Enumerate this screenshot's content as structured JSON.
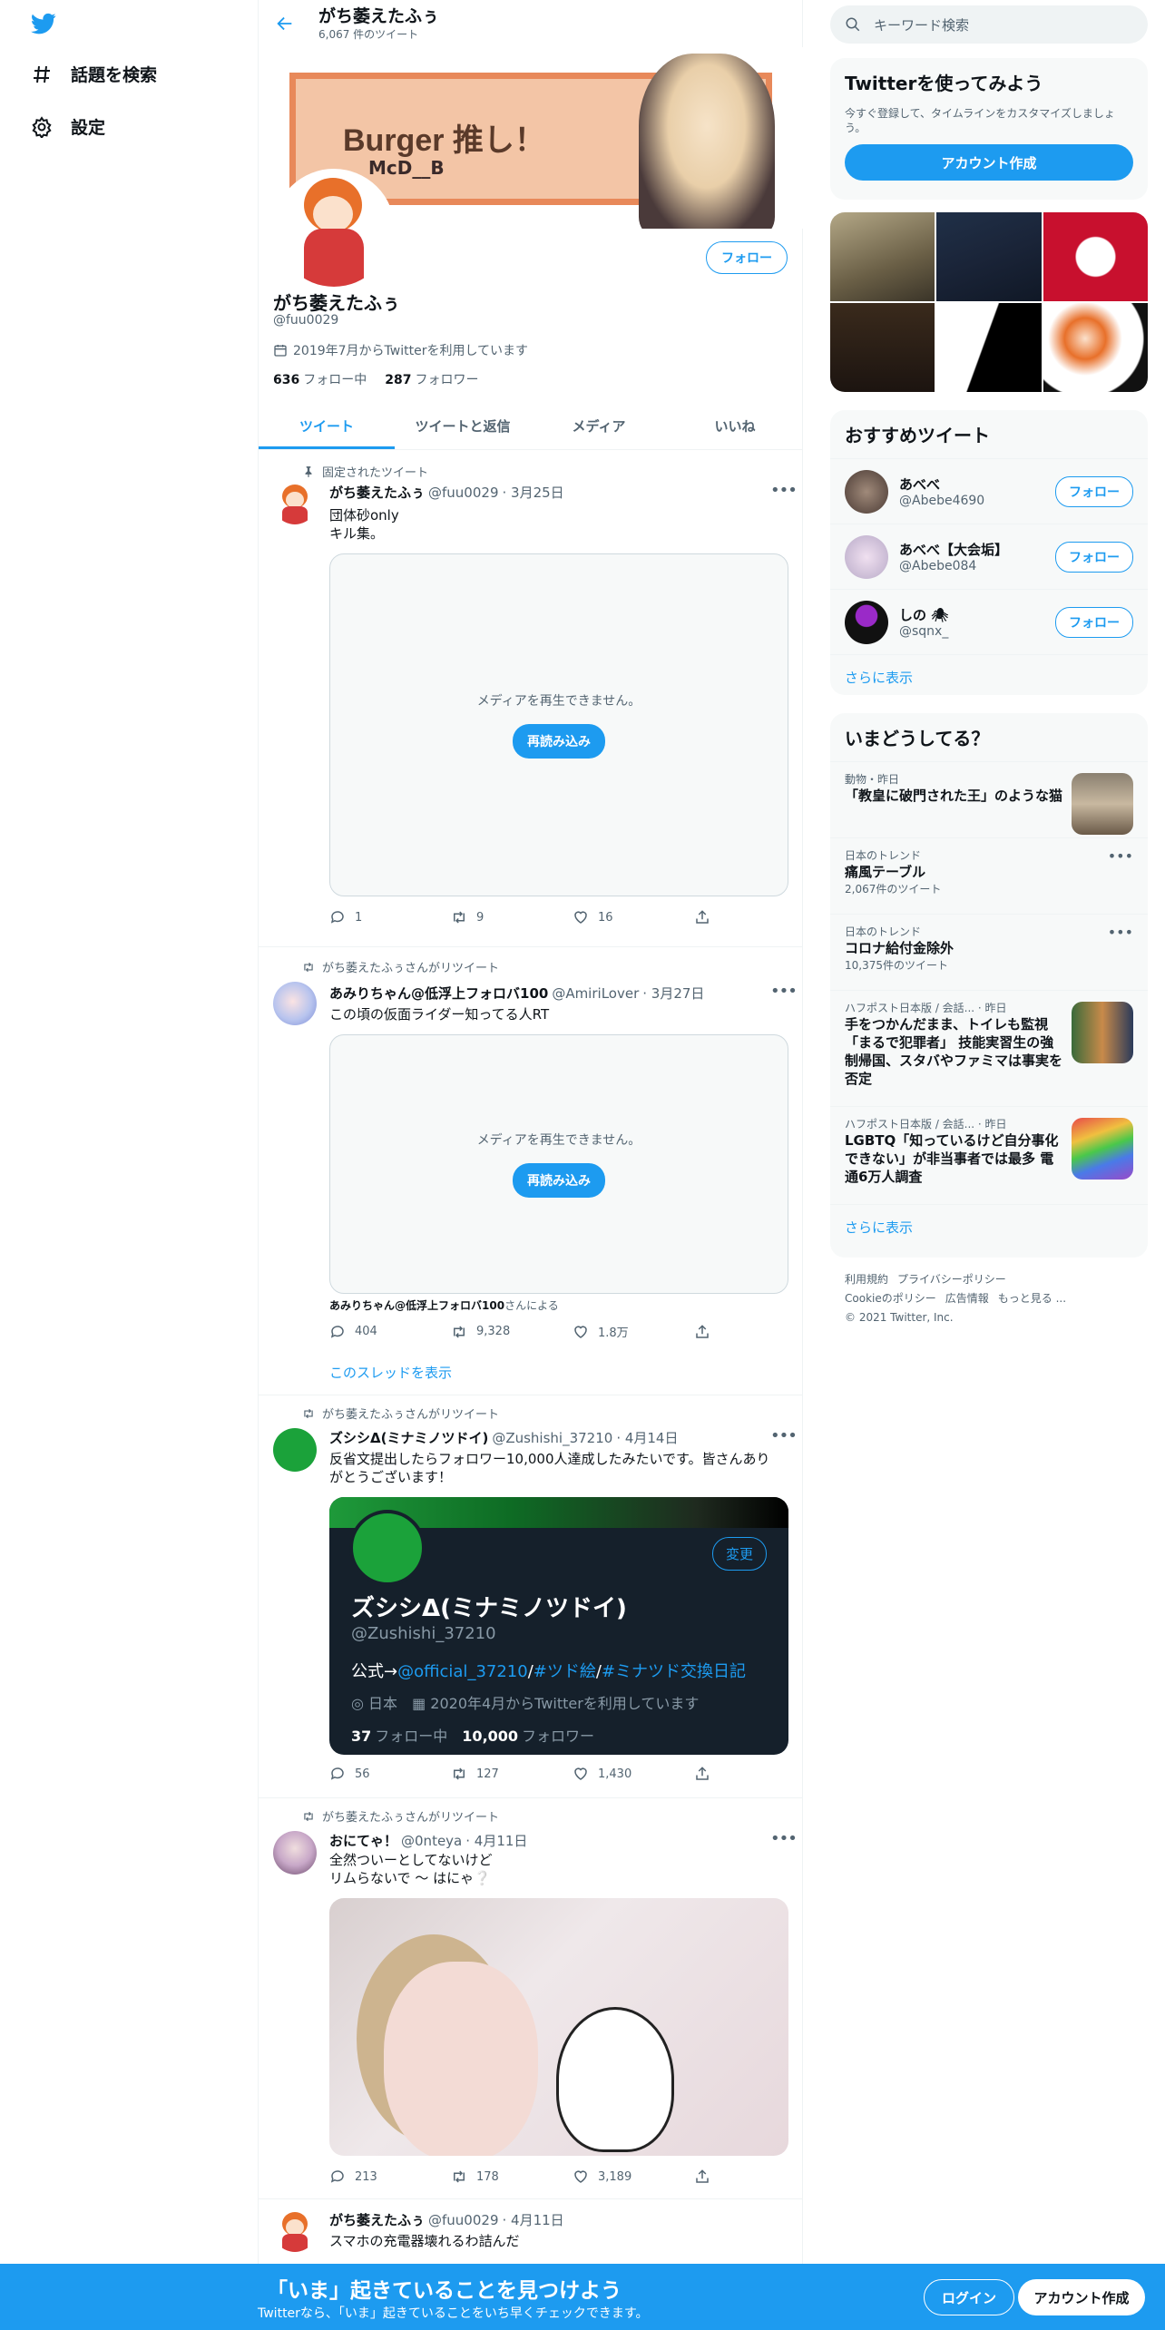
{
  "nav": {
    "explore": "話題を検索",
    "settings": "設定"
  },
  "header": {
    "name": "がち萎えたふぅ",
    "tweet_count": "6,067 件のツイート"
  },
  "banner": {
    "title": "Burger 推し！",
    "sub": "McD__B"
  },
  "profile": {
    "follow": "フォロー",
    "name": "がち萎えたふぅ",
    "handle": "@fuu0029",
    "joined": "2019年7月からTwitterを利用しています",
    "following_count": "636",
    "following_label": "フォロー中",
    "followers_count": "287",
    "followers_label": "フォロワー"
  },
  "tabs": [
    "ツイート",
    "ツイートと返信",
    "メディア",
    "いいね"
  ],
  "tweets": [
    {
      "context": "固定されたツイート",
      "name": "がち萎えたふぅ",
      "handle": "@fuu0029",
      "date": "· 3月25日",
      "text": "団体砂only\nキル集。",
      "media_msg": "メディアを再生できません。",
      "reload": "再読み込み",
      "reply": "1",
      "retweet": "9",
      "like": "16"
    },
    {
      "context": "がち萎えたふぅさんがリツイート",
      "name": "あみりちゃん@低浮上フォロバ100",
      "handle": "@AmiriLover",
      "date": "· 3月27日",
      "text": "この頃の仮面ライダー知ってる人RT",
      "media_msg": "メディアを再生できません。",
      "reload": "再読み込み",
      "by_name": "あみりちゃん@低浮上フォロバ100",
      "by_suffix": "さんによる",
      "reply": "404",
      "retweet": "9,328",
      "like": "1.8万",
      "thread": "このスレッドを表示"
    },
    {
      "context": "がち萎えたふぅさんがリツイート",
      "name": "ズシシΔ(ミナミノツドイ)",
      "handle": "@Zushishi_37210",
      "date": "· 4月14日",
      "text": "反省文提出したらフォロワー10,000人達成したみたいです。皆さんありがとうございます！",
      "card": {
        "change": "変更",
        "name": "ズシシΔ(ミナミノツドイ)",
        "handle": "@Zushishi_37210",
        "bio_prefix": "公式→",
        "bio_link1": "@official_37210",
        "bio_sep1": "/",
        "bio_link2": "#ツド絵",
        "bio_sep2": "/",
        "bio_link3": "#ミナツド交換日記",
        "location": "日本",
        "joined": "2020年4月からTwitterを利用しています",
        "following_count": "37",
        "following_label": "フォロー中",
        "followers_count": "10,000",
        "followers_label": "フォロワー"
      },
      "reply": "56",
      "retweet": "127",
      "like": "1,430"
    },
    {
      "context": "がち萎えたふぅさんがリツイート",
      "name": "おにてゃ！",
      "handle": "@0nteya",
      "date": "· 4月11日",
      "text": "全然ついーとしてないけど\nリムらないで ～ はにゃ❔",
      "reply": "213",
      "retweet": "178",
      "like": "3,189"
    },
    {
      "name": "がち萎えたふぅ",
      "handle": "@fuu0029",
      "date": "· 4月11日",
      "text": "スマホの充電器壊れるわ詰んだ"
    }
  ],
  "right": {
    "search_placeholder": "キーワード検索",
    "signup_title": "Twitterを使ってみよう",
    "signup_desc": "今すぐ登録して、タイムラインをカスタマイズしましょう。",
    "signup_btn": "アカウント作成",
    "rec_title": "おすすめツイート",
    "recs": [
      {
        "name": "あべべ",
        "handle": "@Abebe4690",
        "follow": "フォロー"
      },
      {
        "name": "あべべ【大会垢】",
        "handle": "@Abebe084",
        "follow": "フォロー"
      },
      {
        "name": "しの 🕷",
        "handle": "@sqnx_",
        "follow": "フォロー"
      }
    ],
    "show_more": "さらに表示",
    "trends_title": "いまどうしてる？",
    "trends": [
      {
        "cat": "動物・昨日",
        "title": "「教皇に破門された王」のような猫",
        "count": ""
      },
      {
        "cat": "日本のトレンド",
        "title": "痛風テーブル",
        "count": "2,067件のツイート"
      },
      {
        "cat": "日本のトレンド",
        "title": "コロナ給付金除外",
        "count": "10,375件のツイート"
      },
      {
        "cat": "ハフポスト日本版 / 会話... · 昨日",
        "title": "手をつかんだまま、トイレも監視「まるで犯罪者」 技能実習生の強制帰国、スタバやファミマは事実を否定",
        "count": ""
      },
      {
        "cat": "ハフポスト日本版 / 会話... · 昨日",
        "title": "LGBTQ「知っているけど自分事化できない」が非当事者では最多 電通6万人調査",
        "count": ""
      }
    ],
    "trends_more": "さらに表示",
    "footer": {
      "terms": "利用規約",
      "privacy": "プライバシーポリシー",
      "cookie": "Cookieのポリシー",
      "ads": "広告情報",
      "more": "もっと見る ...",
      "copyright": "© 2021 Twitter, Inc."
    }
  },
  "bottom": {
    "title": "「いま」起きていることを見つけよう",
    "sub": "Twitterなら、「いま」起きていることをいち早くチェックできます。",
    "login": "ログイン",
    "signup": "アカウント作成"
  },
  "colors": {
    "accent": "#1d9bf0",
    "text": "#0f1419",
    "muted": "#536471"
  }
}
